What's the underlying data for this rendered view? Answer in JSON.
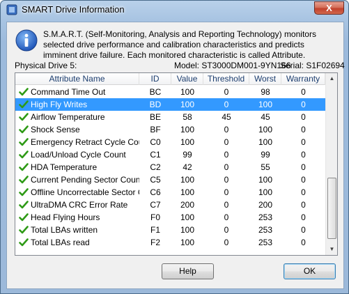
{
  "window": {
    "title": "SMART Drive Information",
    "close_glyph": "X"
  },
  "description": "S.M.A.R.T. (Self-Monitoring, Analysis and Reporting Technology) monitors selected drive performance and calibration characteristics and predicts imminent drive failure. Each monitored characteristic is called Attribute.",
  "drive": {
    "label": "Physical Drive 5:",
    "model": "Model: ST3000DM001-9YN166",
    "serial": "Serial: S1F02694"
  },
  "columns": [
    "Attribute Name",
    "ID",
    "Value",
    "Threshold",
    "Worst",
    "Warranty"
  ],
  "rows": [
    {
      "name": "Command Time Out",
      "id": "BC",
      "value": "100",
      "threshold": "0",
      "worst": "98",
      "warranty": "0"
    },
    {
      "name": "High Fly Writes",
      "id": "BD",
      "value": "100",
      "threshold": "0",
      "worst": "100",
      "warranty": "0"
    },
    {
      "name": "Airflow Temperature",
      "id": "BE",
      "value": "58",
      "threshold": "45",
      "worst": "45",
      "warranty": "0"
    },
    {
      "name": "Shock Sense",
      "id": "BF",
      "value": "100",
      "threshold": "0",
      "worst": "100",
      "warranty": "0"
    },
    {
      "name": "Emergency Retract Cycle Count",
      "id": "C0",
      "value": "100",
      "threshold": "0",
      "worst": "100",
      "warranty": "0"
    },
    {
      "name": "Load/Unload Cycle Count",
      "id": "C1",
      "value": "99",
      "threshold": "0",
      "worst": "99",
      "warranty": "0"
    },
    {
      "name": "HDA Temperature",
      "id": "C2",
      "value": "42",
      "threshold": "0",
      "worst": "55",
      "warranty": "0"
    },
    {
      "name": "Current Pending Sector Count",
      "id": "C5",
      "value": "100",
      "threshold": "0",
      "worst": "100",
      "warranty": "0"
    },
    {
      "name": "Offline Uncorrectable Sector Count",
      "id": "C6",
      "value": "100",
      "threshold": "0",
      "worst": "100",
      "warranty": "0"
    },
    {
      "name": "UltraDMA CRC Error Rate",
      "id": "C7",
      "value": "200",
      "threshold": "0",
      "worst": "200",
      "warranty": "0"
    },
    {
      "name": "Head Flying Hours",
      "id": "F0",
      "value": "100",
      "threshold": "0",
      "worst": "253",
      "warranty": "0"
    },
    {
      "name": "Total LBAs written",
      "id": "F1",
      "value": "100",
      "threshold": "0",
      "worst": "253",
      "warranty": "0"
    },
    {
      "name": "Total LBAs read",
      "id": "F2",
      "value": "100",
      "threshold": "0",
      "worst": "253",
      "warranty": "0"
    }
  ],
  "selected_row": 1,
  "buttons": {
    "help": "Help",
    "ok": "OK"
  },
  "colors": {
    "selection": "#3399ff",
    "check": "#2e9a16",
    "header_text": "#1c3d6e"
  }
}
